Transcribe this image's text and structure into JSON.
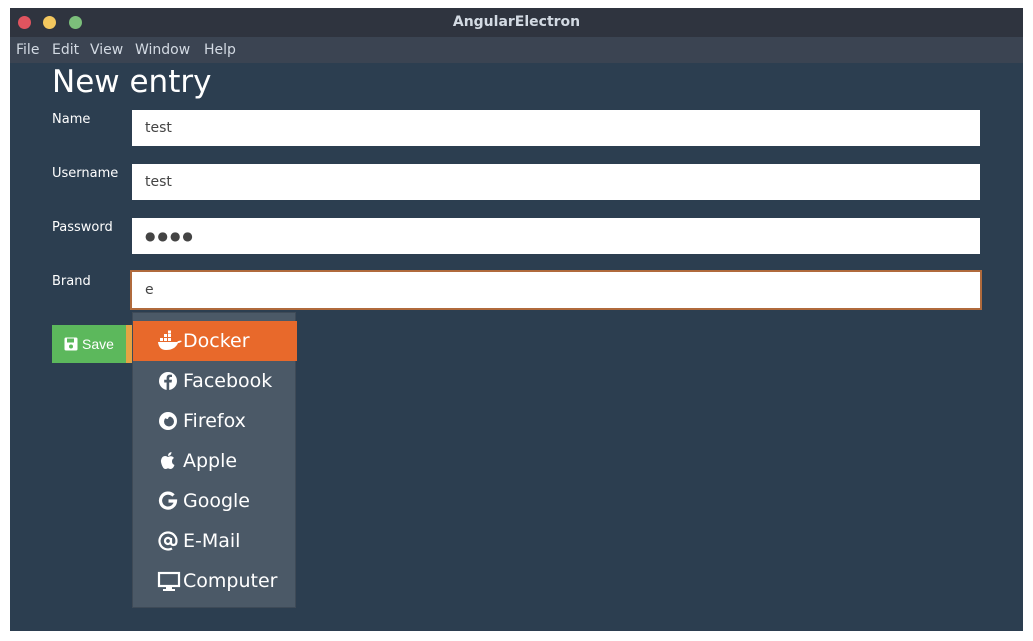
{
  "window": {
    "title": "AngularElectron"
  },
  "menu": [
    {
      "label": "File"
    },
    {
      "label": "Edit"
    },
    {
      "label": "View"
    },
    {
      "label": "Window"
    },
    {
      "label": "Help"
    }
  ],
  "page": {
    "title": "New entry"
  },
  "form": {
    "name": {
      "label": "Name",
      "value": "test"
    },
    "username": {
      "label": "Username",
      "value": "test"
    },
    "password": {
      "label": "Password",
      "value": "●●●●"
    },
    "brand": {
      "label": "Brand",
      "value": "e"
    }
  },
  "save_button": {
    "label": "Save",
    "icon": "floppy-disk-icon"
  },
  "brand_options": [
    {
      "label": "Docker",
      "icon": "docker-icon",
      "selected": true
    },
    {
      "label": "Facebook",
      "icon": "facebook-icon"
    },
    {
      "label": "Firefox",
      "icon": "firefox-icon"
    },
    {
      "label": "Apple",
      "icon": "apple-icon"
    },
    {
      "label": "Google",
      "icon": "google-icon"
    },
    {
      "label": "E-Mail",
      "icon": "at-icon"
    },
    {
      "label": "Computer",
      "icon": "desktop-icon"
    }
  ],
  "colors": {
    "background": "#2c3e50",
    "accent": "#e8692b",
    "save": "#5cb85c"
  }
}
